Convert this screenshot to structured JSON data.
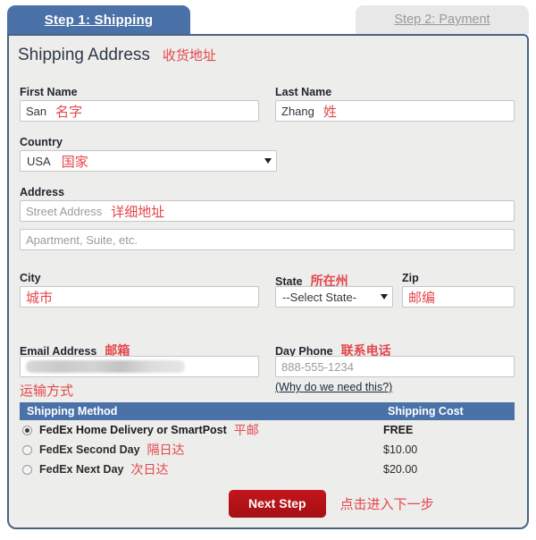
{
  "tabs": [
    {
      "label": "Step 1: Shipping",
      "state": "active"
    },
    {
      "label": "Step 2: Payment",
      "state": "inactive"
    }
  ],
  "section": {
    "title": "Shipping Address",
    "annotation": "收货地址"
  },
  "fields": {
    "first_name": {
      "label": "First Name",
      "value": "San",
      "annotation": "名字"
    },
    "last_name": {
      "label": "Last Name",
      "value": "Zhang",
      "annotation": "姓"
    },
    "country": {
      "label": "Country",
      "value": "USA",
      "annotation": "国家"
    },
    "address": {
      "label": "Address"
    },
    "street": {
      "placeholder": "Street Address",
      "annotation": "详细地址"
    },
    "apartment": {
      "placeholder": "Apartment, Suite, etc."
    },
    "city": {
      "label": "City",
      "value": "",
      "annotation": "城市"
    },
    "state": {
      "label": "State",
      "value": "--Select State-",
      "annotation": "所在州"
    },
    "zip": {
      "label": "Zip",
      "value": "",
      "annotation": "邮编"
    },
    "email": {
      "label": "Email Address",
      "annotation": "邮箱",
      "value_redacted": true,
      "note": "运输方式"
    },
    "phone": {
      "label": "Day Phone",
      "annotation": "联系电话",
      "placeholder": "888-555-1234",
      "help_link": "(Why do we need this?)"
    }
  },
  "shipping": {
    "columns": {
      "method": "Shipping Method",
      "cost": "Shipping Cost"
    },
    "options": [
      {
        "name": "FedEx Home Delivery or SmartPost",
        "cost": "FREE",
        "selected": true,
        "annotation": "平邮"
      },
      {
        "name": "FedEx Second Day",
        "cost": "$10.00",
        "selected": false,
        "annotation": "隔日达"
      },
      {
        "name": "FedEx Next Day",
        "cost": "$20.00",
        "selected": false,
        "annotation": "次日达"
      }
    ]
  },
  "footer": {
    "next_label": "Next Step",
    "next_annotation": "点击进入下一步"
  },
  "colors": {
    "accent_blue": "#4a72a8",
    "panel_border": "#4a6385",
    "panel_bg": "#ededec",
    "annotation_red": "#e4464b",
    "button_red": "#b01217"
  }
}
